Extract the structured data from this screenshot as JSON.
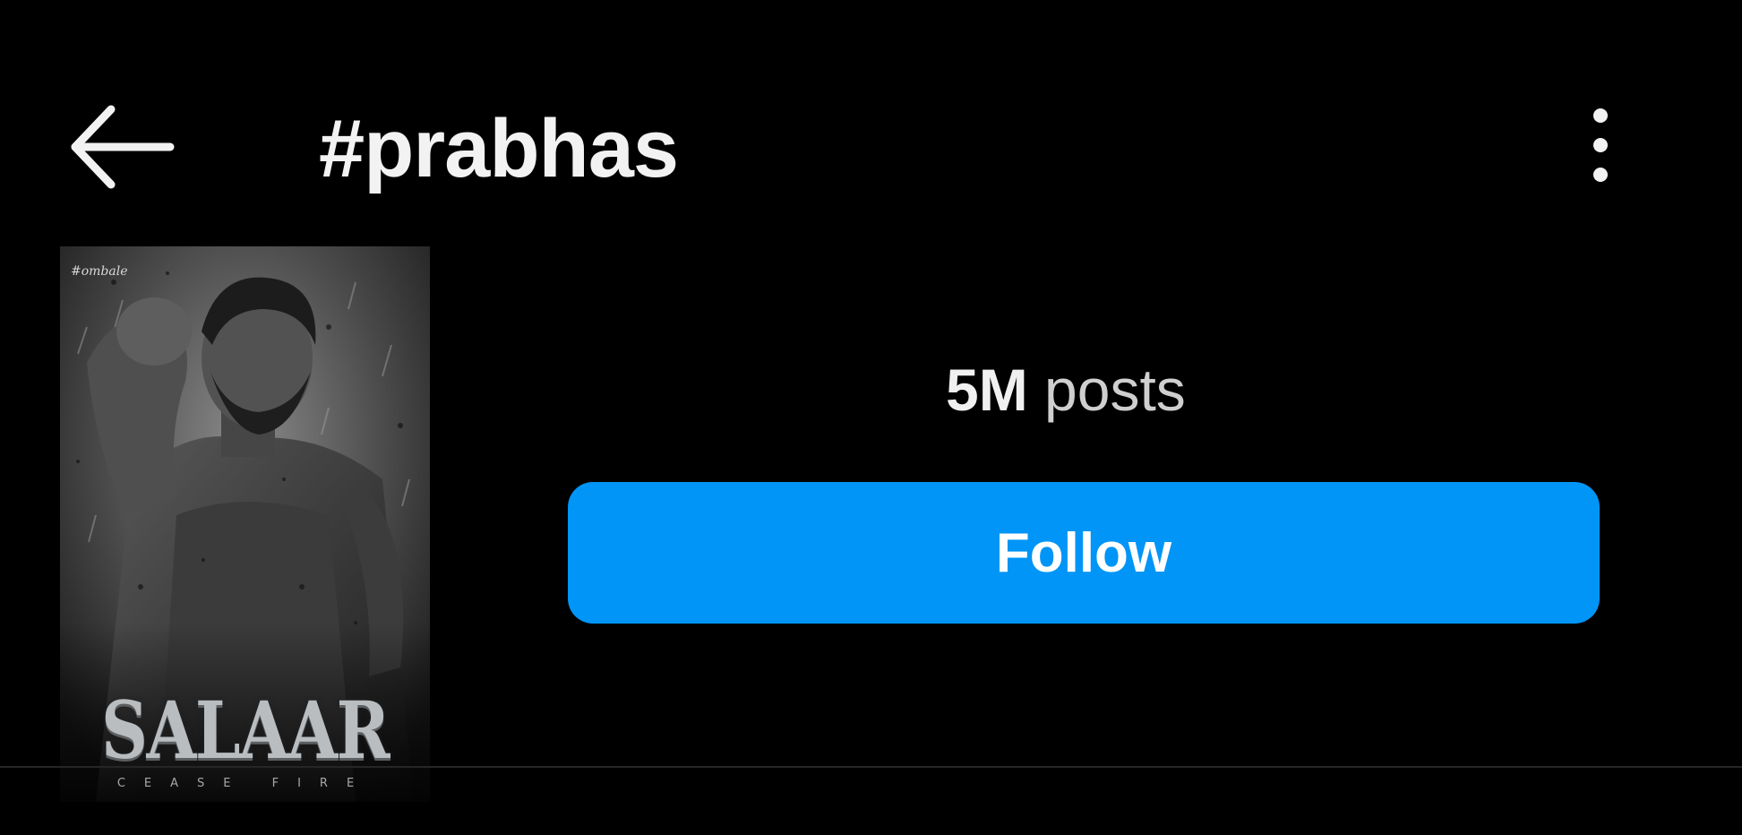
{
  "header": {
    "title": "#prabhas",
    "back_icon": "arrow-left-icon",
    "more_icon": "vertical-ellipsis-icon"
  },
  "profile_image": {
    "brand": "#ombale",
    "title": "SALAAR",
    "subtitle": "CEASE FIRE"
  },
  "stats": {
    "posts_count": "5M",
    "posts_label": "posts"
  },
  "actions": {
    "follow_label": "Follow"
  },
  "colors": {
    "background": "#000000",
    "accent": "#0095f6",
    "text": "#ffffff"
  }
}
